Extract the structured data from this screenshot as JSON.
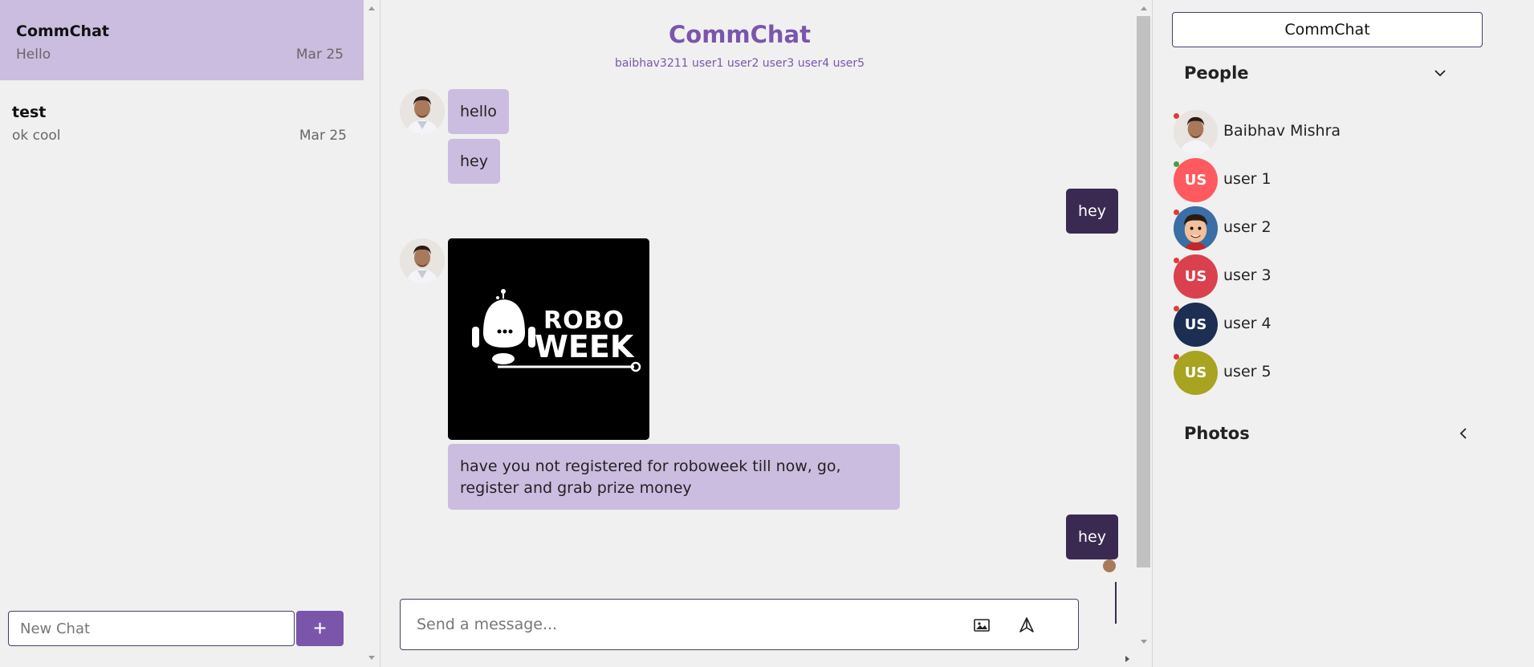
{
  "left_panel": {
    "chats": [
      {
        "name": "CommChat",
        "preview": "Hello",
        "date": "Mar 25",
        "active": true
      },
      {
        "name": "test",
        "preview": "ok cool",
        "date": "Mar 25",
        "active": false
      }
    ],
    "new_chat_placeholder": "New Chat",
    "add_label": "+"
  },
  "chat": {
    "title": "CommChat",
    "members": "baibhav3211 user1 user2 user3 user4 user5",
    "messages": [
      {
        "text": "hello",
        "direction": "in"
      },
      {
        "text": "hey",
        "direction": "in"
      },
      {
        "text": "hey",
        "direction": "out"
      },
      {
        "image": "ROBO WEEK logo",
        "direction": "in"
      },
      {
        "text": "have you not registered for roboweek till now, go, register and grab prize money",
        "direction": "in"
      },
      {
        "text": "hey",
        "direction": "out"
      }
    ],
    "image_text": {
      "line1": "ROBO",
      "line2": "WEEK"
    },
    "input_placeholder": "Send a message..."
  },
  "right_panel": {
    "chat_name": "CommChat",
    "people_label": "People",
    "photos_label": "Photos",
    "people": [
      {
        "name": "Baibhav Mishra",
        "initials": "",
        "color": "#cfd8dc",
        "status": "#e53935"
      },
      {
        "name": "user 1",
        "initials": "US",
        "color": "#ff5a5f",
        "status": "#43a047"
      },
      {
        "name": "user 2",
        "initials": "",
        "color": "#3a6ea5",
        "status": "#e53935"
      },
      {
        "name": "user 3",
        "initials": "US",
        "color": "#d9414f",
        "status": "#e53935"
      },
      {
        "name": "user 4",
        "initials": "US",
        "color": "#1c2e52",
        "status": "#e53935"
      },
      {
        "name": "user 5",
        "initials": "US",
        "color": "#a8a320",
        "status": "#e53935"
      }
    ]
  },
  "colors": {
    "accent": "#7a56ab",
    "bubble_in": "#cbbde0",
    "bubble_out": "#3a2a52"
  }
}
